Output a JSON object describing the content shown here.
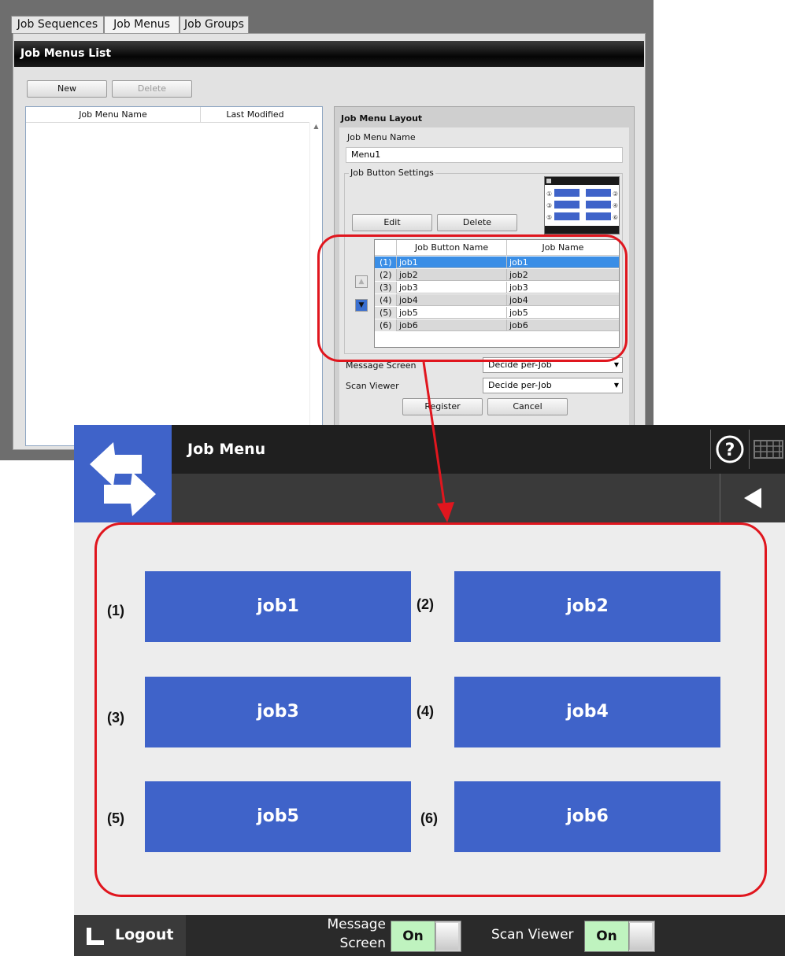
{
  "admin": {
    "tabs": [
      "Job Sequences",
      "Job Menus",
      "Job Groups"
    ],
    "active_tab": "Job Menus",
    "list_title": "Job Menus List",
    "new_label": "New",
    "delete_label": "Delete",
    "columns": [
      "Job Menu Name",
      "Last Modified"
    ],
    "layout": {
      "title": "Job Menu Layout",
      "menu_name_label": "Job Menu Name",
      "menu_name_value": "Menu1",
      "button_settings_label": "Job Button Settings",
      "edit_label": "Edit",
      "delete_label": "Delete",
      "table_columns": [
        "Job Button Name",
        "Job Name"
      ],
      "rows": [
        {
          "num": "(1)",
          "button": "job1",
          "job": "job1"
        },
        {
          "num": "(2)",
          "button": "job2",
          "job": "job2"
        },
        {
          "num": "(3)",
          "button": "job3",
          "job": "job3"
        },
        {
          "num": "(4)",
          "button": "job4",
          "job": "job4"
        },
        {
          "num": "(5)",
          "button": "job5",
          "job": "job5"
        },
        {
          "num": "(6)",
          "button": "job6",
          "job": "job6"
        }
      ],
      "message_screen_label": "Message Screen",
      "message_screen_value": "Decide per-Job",
      "scan_viewer_label": "Scan Viewer",
      "scan_viewer_value": "Decide per-Job",
      "register_label": "Register",
      "cancel_label": "Cancel"
    }
  },
  "device": {
    "title": "Job Menu",
    "jobs": [
      {
        "num": "(1)",
        "label": "job1"
      },
      {
        "num": "(2)",
        "label": "job2"
      },
      {
        "num": "(3)",
        "label": "job3"
      },
      {
        "num": "(4)",
        "label": "job4"
      },
      {
        "num": "(5)",
        "label": "job5"
      },
      {
        "num": "(6)",
        "label": "job6"
      }
    ],
    "logout_label": "Logout",
    "message_screen_line1": "Message",
    "message_screen_line2": "Screen",
    "message_toggle": "On",
    "scan_viewer_label": "Scan Viewer",
    "scan_viewer_toggle": "On"
  },
  "colors": {
    "job_button": "#3f63c9",
    "annotation": "#e0161e",
    "row_selected": "#3a8ee6"
  }
}
